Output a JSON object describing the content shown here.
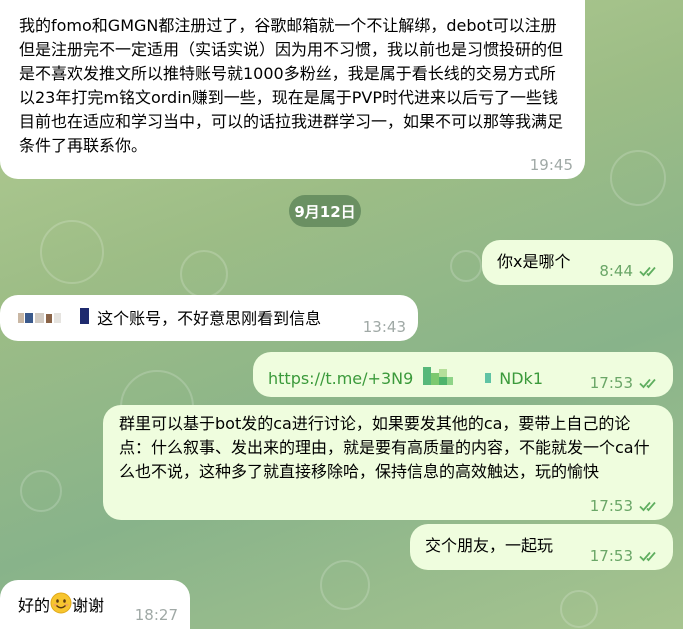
{
  "messages": [
    {
      "text": "我的fomo和GMGN都注册过了，谷歌邮箱就一个不让解绑，debot可以注册但是注册完不一定适用（实话实说）因为用不习惯，我以前也是习惯投研的但是不喜欢发推文所以推特账号就1000多粉丝，我是属于看长线的交易方式所以23年打完m铭文ordin赚到一些，现在是属于PVP时代进来以后亏了一些钱目前也在适应和学习当中，可以的话拉我进群学习一，如果不可以那等我满足条件了再联系你。",
      "time": "19:45"
    },
    {
      "text": "你x是哪个",
      "time": "8:44"
    },
    {
      "text": "这个账号，不好意思刚看到信息",
      "time": "13:43"
    },
    {
      "text_left": "https://t.me/+3N9",
      "text_right": "NDk1",
      "time": "17:53"
    },
    {
      "text": "群里可以基于bot发的ca进行讨论，如果要发其他的ca，要带上自己的论点：什么叙事、发出来的理由，就是要有高质量的内容，不能就发一个ca什么也不说，这种多了就直接移除哈，保持信息的高效触达，玩的愉快",
      "time": "17:53"
    },
    {
      "text": "交个朋友，一起玩",
      "time": "17:53"
    },
    {
      "text_before": "好的",
      "text_after": "谢谢",
      "time": "18:27"
    }
  ],
  "date_separator": "9月12日",
  "icons": {
    "read_status": "double-check-icon",
    "emoji": "smiling-face-icon"
  },
  "colors": {
    "incoming_bubble": "#ffffff",
    "outgoing_bubble": "#effdde",
    "outgoing_time": "#6aa667",
    "incoming_time": "#a0a9a6",
    "link": "#3b9a3b",
    "date_pill": "#5c8458"
  }
}
